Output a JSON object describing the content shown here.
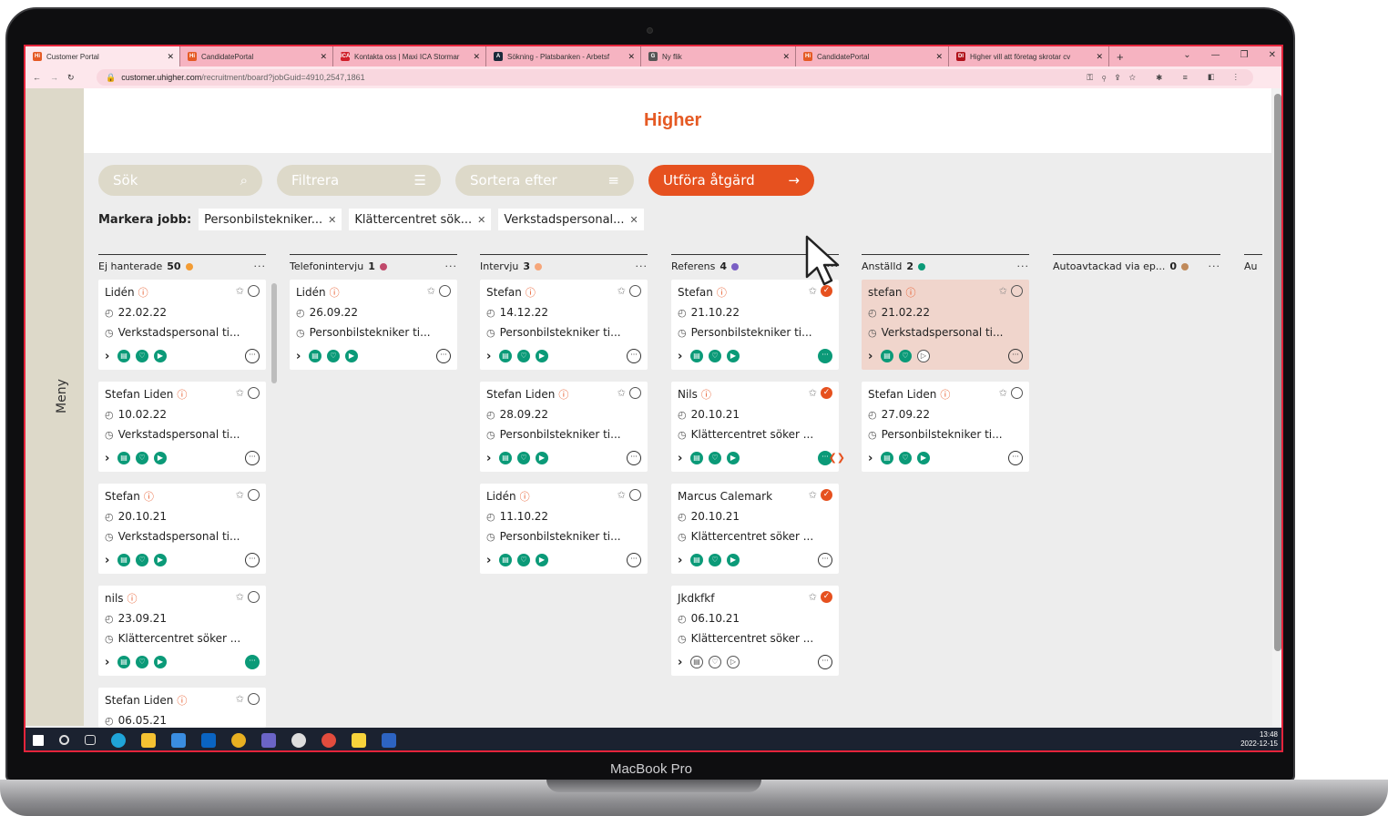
{
  "device": {
    "brand": "MacBook Pro"
  },
  "browser": {
    "tabs": [
      {
        "title": "Customer Portal",
        "favicon": "Hi",
        "active": true
      },
      {
        "title": "CandidatePortal",
        "favicon": "Hi"
      },
      {
        "title": "Kontakta oss | Maxi ICA Stormar",
        "favicon": "ICA"
      },
      {
        "title": "Sökning - Platsbanken - Arbetsf",
        "favicon": "A"
      },
      {
        "title": "Ny flik",
        "favicon": "G"
      },
      {
        "title": "CandidatePortal",
        "favicon": "Hi"
      },
      {
        "title": "Higher vill att företag skrotar cv",
        "favicon": "DI"
      }
    ],
    "new_tab": "+",
    "url_host": "customer.uhigher.com",
    "url_path": "/recruitment/board?jobGuid=4910,2547,1861"
  },
  "app": {
    "logo": "Higher",
    "menu": "Meny",
    "search_placeholder": "Sök",
    "filter_label": "Filtrera",
    "sort_label": "Sortera efter",
    "action_label": "Utföra åtgärd",
    "mark_jobs_label": "Markera jobb:",
    "job_chips": [
      "Personbilstekniker...",
      "Klättercentret sök...",
      "Verkstadspersonal..."
    ],
    "columns": [
      {
        "title": "Ej hanterade",
        "count": "50",
        "dot": "#f39c34",
        "cards": [
          {
            "name": "Lidén",
            "date": "22.02.22",
            "job": "Verkstadspersonal ti..."
          },
          {
            "name": "Stefan Liden",
            "date": "10.02.22",
            "job": "Verkstadspersonal ti..."
          },
          {
            "name": "Stefan",
            "date": "20.10.21",
            "job": "Verkstadspersonal ti..."
          },
          {
            "name": "nils",
            "date": "23.09.21",
            "job": "Klättercentret söker ...",
            "chat_green": true
          },
          {
            "name": "Stefan Liden",
            "date": "06.05.21",
            "job": ""
          }
        ]
      },
      {
        "title": "Telefonintervju",
        "count": "1",
        "dot": "#c0496b",
        "cards": [
          {
            "name": "Lidén",
            "date": "26.09.22",
            "job": "Personbilstekniker ti..."
          }
        ]
      },
      {
        "title": "Intervju",
        "count": "3",
        "dot": "#f6a67a",
        "cards": [
          {
            "name": "Stefan",
            "date": "14.12.22",
            "job": "Personbilstekniker ti..."
          },
          {
            "name": "Stefan Liden",
            "date": "28.09.22",
            "job": "Personbilstekniker ti..."
          },
          {
            "name": "Lidén",
            "date": "11.10.22",
            "job": "Personbilstekniker ti..."
          }
        ]
      },
      {
        "title": "Referens",
        "count": "4",
        "dot": "#7a5fc4",
        "cards": [
          {
            "name": "Stefan",
            "date": "21.10.22",
            "job": "Personbilstekniker ti...",
            "done": true,
            "chat_green": true
          },
          {
            "name": "Nils",
            "date": "20.10.21",
            "job": "Klättercentret söker ...",
            "done": true,
            "chat_green": true,
            "flag": true
          },
          {
            "name": "Marcus Calemark",
            "date": "20.10.21",
            "job": "Klättercentret söker ...",
            "done": true,
            "no_info": true
          },
          {
            "name": "Jkdkfkf",
            "date": "06.10.21",
            "job": "Klättercentret söker ...",
            "done": true,
            "no_info": true,
            "outline": true
          }
        ]
      },
      {
        "title": "Anställd",
        "count": "2",
        "dot": "#0b9a78",
        "cards": [
          {
            "name": "stefan",
            "date": "21.02.22",
            "job": "Verkstadspersonal ti...",
            "highlight": true,
            "partial_outline": true
          },
          {
            "name": "Stefan Liden",
            "date": "27.09.22",
            "job": "Personbilstekniker ti..."
          }
        ]
      },
      {
        "title": "Autoavtackad via ep...",
        "count": "0",
        "dot": "#c08a5a",
        "cards": []
      },
      {
        "title": "Au",
        "count": "",
        "dot": "",
        "cards": []
      }
    ]
  },
  "taskbar": {
    "time": "13:48",
    "date": "2022-12-15"
  }
}
